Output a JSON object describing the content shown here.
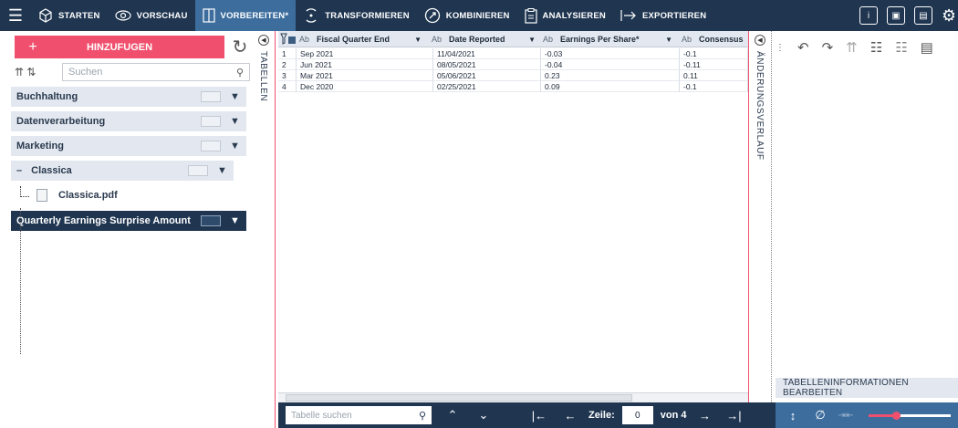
{
  "topbar": {
    "tabs": [
      {
        "label": "STARTEN",
        "icon": "cube-icon"
      },
      {
        "label": "VORSCHAU",
        "icon": "eye-icon"
      },
      {
        "label": "VORBEREITEN*",
        "icon": "columns-icon",
        "active": true
      },
      {
        "label": "TRANSFORMIEREN",
        "icon": "transform-icon"
      },
      {
        "label": "KOMBINIEREN",
        "icon": "combine-icon"
      },
      {
        "label": "ANALYSIEREN",
        "icon": "clipboard-icon"
      },
      {
        "label": "EXPORTIEREN",
        "icon": "export-arrow-icon"
      }
    ],
    "right_icons": [
      "info-icon",
      "window-icon",
      "book-icon",
      "settings-icon"
    ]
  },
  "left": {
    "add_label": "HINZUFUGEN",
    "search_placeholder": "Suchen",
    "groups": [
      "Buchhaltung",
      "Datenverarbeitung",
      "Marketing",
      "Classica"
    ],
    "file": "Classica.pdf",
    "selected_table": "Quarterly Earnings Surprise Amount",
    "vertical_tab": "TABELLEN"
  },
  "grid": {
    "columns": [
      {
        "type": "Ab",
        "name": "Fiscal Quarter End"
      },
      {
        "type": "Ab",
        "name": "Date Reported"
      },
      {
        "type": "Ab",
        "name": "Earnings Per Share*"
      },
      {
        "type": "Ab",
        "name": "Consensus"
      }
    ],
    "rows": [
      [
        "1",
        "Sep 2021",
        "11/04/2021",
        "-0.03",
        "-0.1"
      ],
      [
        "2",
        "Jun 2021",
        "08/05/2021",
        "-0.04",
        "-0.11"
      ],
      [
        "3",
        "Mar 2021",
        "05/06/2021",
        "0.23",
        "0.11"
      ],
      [
        "4",
        "Dec 2020",
        "02/25/2021",
        "0.09",
        "-0.1"
      ]
    ]
  },
  "right": {
    "vertical_tab": "ÄNDERUNGSVERLAUF",
    "edit_info_label": "TABELLENINFORMATIONEN BEARBEITEN"
  },
  "bottom": {
    "table_search_placeholder": "Tabelle suchen",
    "row_label": "Zeile:",
    "row_value": "0",
    "of_label": "von 4"
  },
  "colors": {
    "topbar": "#1f3550",
    "accent": "#f0506e",
    "active_tab": "#3c6d9d"
  }
}
